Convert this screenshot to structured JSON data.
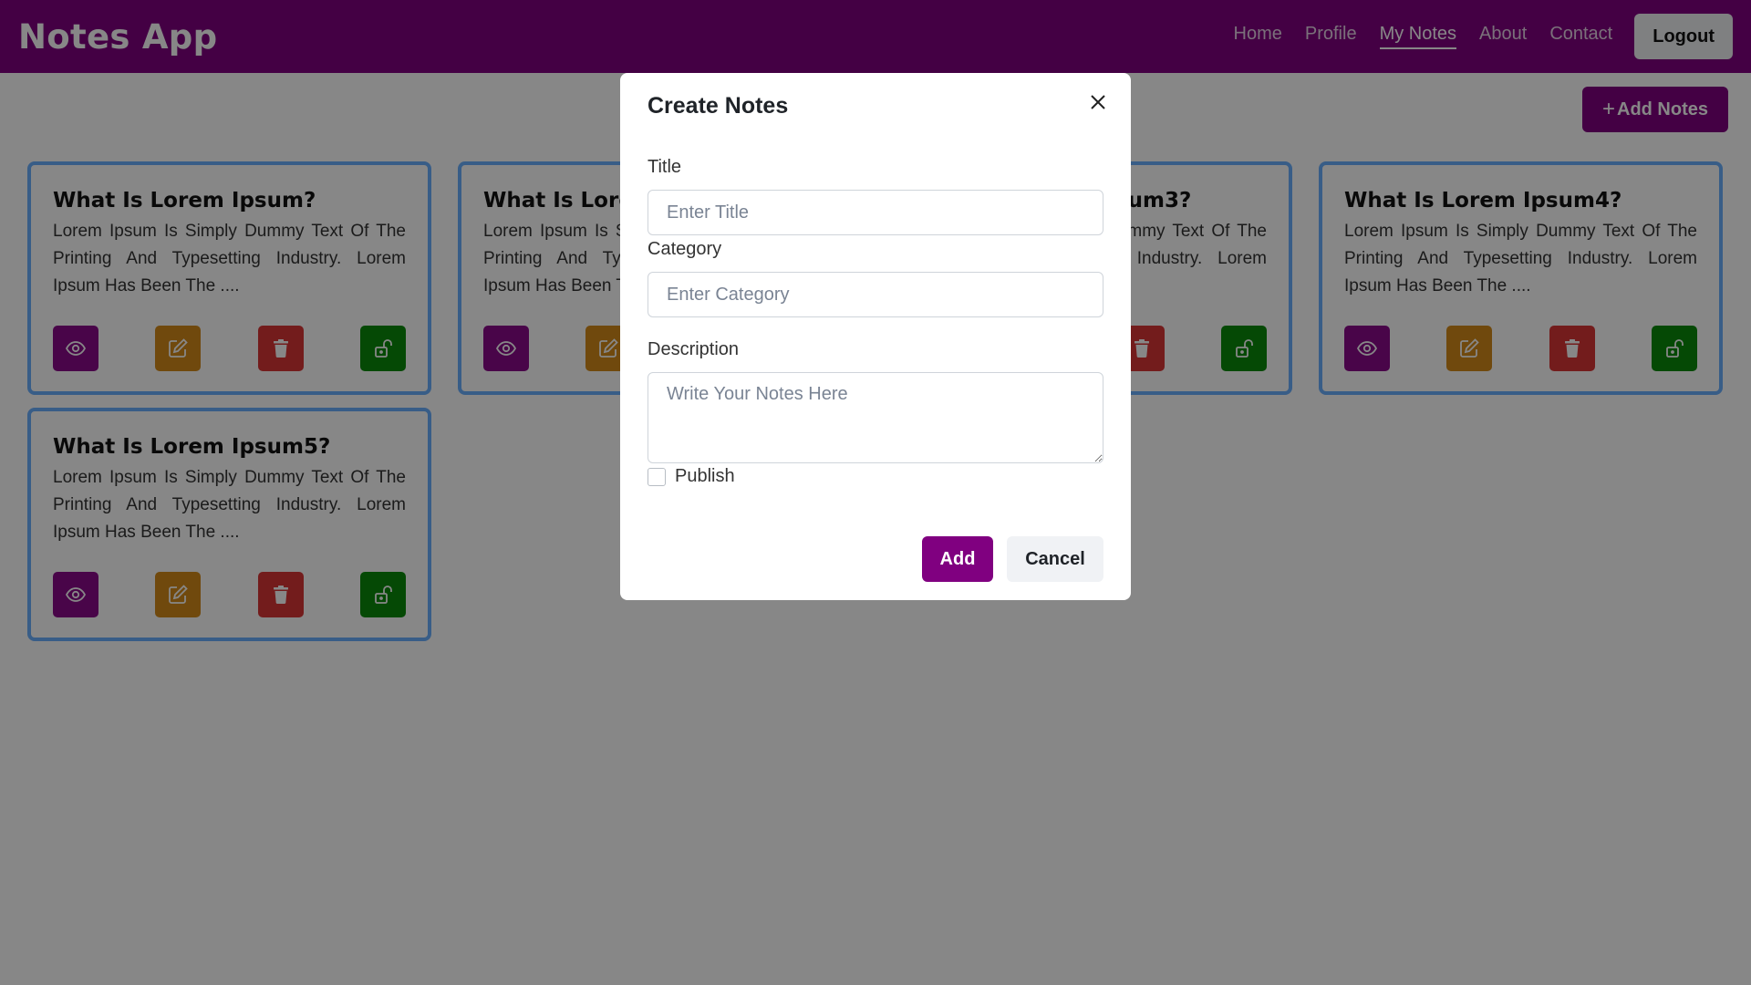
{
  "app": {
    "brand": "Notes App"
  },
  "nav": {
    "items": [
      {
        "label": "Home",
        "active": false
      },
      {
        "label": "Profile",
        "active": false
      },
      {
        "label": "My Notes",
        "active": true
      },
      {
        "label": "About",
        "active": false
      },
      {
        "label": "Contact",
        "active": false
      }
    ],
    "logout_label": "Logout"
  },
  "toolbar": {
    "add_notes_label": "Add Notes",
    "add_notes_icon": "plus-icon"
  },
  "notes": [
    {
      "title": "What Is Lorem Ipsum?",
      "text": "Lorem Ipsum Is Simply Dummy Text Of The Printing And Typesetting Industry. Lorem Ipsum Has Been The ...."
    },
    {
      "title": "What Is Lorem Ipsum2?",
      "text": "Lorem Ipsum Is Simply Dummy Text Of The Printing And Typesetting Industry. Lorem Ipsum Has Been The ...."
    },
    {
      "title": "What Is Lorem Ipsum3?",
      "text": "Lorem Ipsum Is Simply Dummy Text Of The Printing And Typesetting Industry. Lorem Ipsum Has Been The ...."
    },
    {
      "title": "What Is Lorem Ipsum4?",
      "text": "Lorem Ipsum Is Simply Dummy Text Of The Printing And Typesetting Industry. Lorem Ipsum Has Been The ...."
    },
    {
      "title": "What Is Lorem Ipsum5?",
      "text": "Lorem Ipsum Is Simply Dummy Text Of The Printing And Typesetting Industry. Lorem Ipsum Has Been The ...."
    }
  ],
  "card_actions": {
    "icons": [
      "eye-icon",
      "edit-icon",
      "trash-icon",
      "unlock-icon"
    ],
    "colors": {
      "view": "#8b0a8b",
      "edit": "#d48a19",
      "delete": "#d93636",
      "publish": "#0a8a0a"
    }
  },
  "modal": {
    "title": "Create Notes",
    "title_label": "Title",
    "title_placeholder": "Enter Title",
    "category_label": "Category",
    "category_placeholder": "Enter Category",
    "description_label": "Description",
    "description_placeholder": "Write Your Notes Here",
    "publish_label": "Publish",
    "publish_checked": false,
    "add_label": "Add",
    "cancel_label": "Cancel"
  },
  "colors": {
    "brand": "#800080",
    "card_border": "#6ab0ff"
  }
}
